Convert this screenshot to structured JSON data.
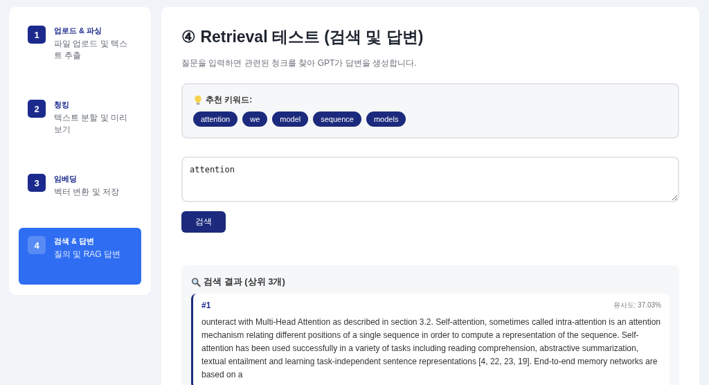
{
  "steps": [
    {
      "number": "1",
      "title": "업로드 & 파싱",
      "description": "파일 업로드 및 텍스트 추출",
      "selected": false
    },
    {
      "number": "2",
      "title": "청킹",
      "description": "텍스트 분할 및 미리보기",
      "selected": false
    },
    {
      "number": "3",
      "title": "임베딩",
      "description": "벡터 변환 및 저장",
      "selected": false
    },
    {
      "number": "4",
      "title": "검색 & 답변",
      "description": "질의 및 RAG 답변",
      "selected": true
    }
  ],
  "page": {
    "title": "④ Retrieval 테스트 (검색 및 답변)",
    "subtitle": "질문을 입력하면 관련된 청크를 찾아 GPT가 답변을 생성합니다."
  },
  "keywords": {
    "label": "추천 키워드:",
    "items": [
      "attention",
      "we",
      "model",
      "sequence",
      "models"
    ]
  },
  "query": {
    "value": "attention"
  },
  "search_button": "검색",
  "results": {
    "title": "검색 결과 (상위 3개)",
    "items": [
      {
        "rank": "#1",
        "similarity": "유사도: 37.03%",
        "text": "ounteract with Multi-Head Attention as described in section 3.2. Self-attention, sometimes called intra-attention is an attention mechanism relating different positions of a single sequence in order to compute a representation of the sequence. Self-attention has been used successfully in a variety of tasks including reading comprehension, abstractive summarization, textual entailment and learning task-independent sentence representations [4, 22, 23, 19]. End-to-end memory networks are based on a"
      }
    ]
  }
}
